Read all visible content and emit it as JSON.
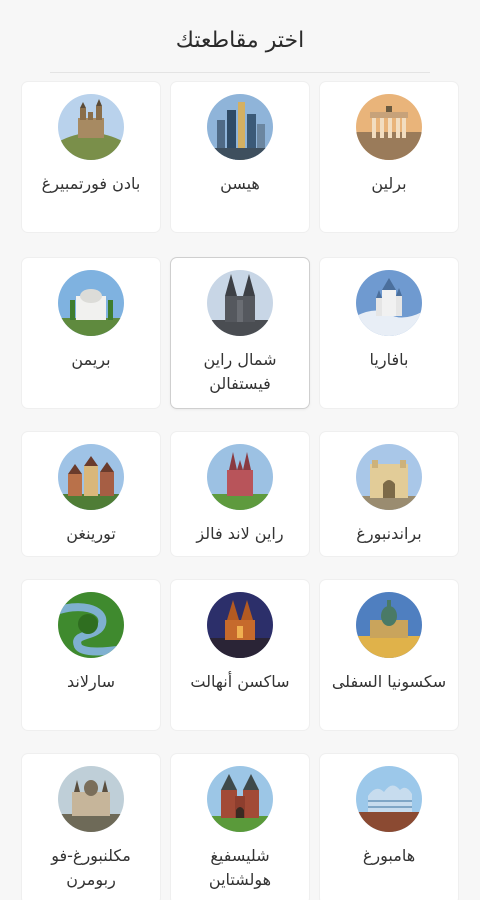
{
  "header": {
    "title": "اختر مقاطعتك"
  },
  "states": [
    {
      "label": "برلين",
      "image": "brandenburg-gate-icon",
      "row": 1
    },
    {
      "label": "هيسن",
      "image": "frankfurt-skyline-icon",
      "row": 1
    },
    {
      "label": "بادن فورتمبيرغ",
      "image": "castle-hohenzollern-icon",
      "row": 1
    },
    {
      "label": "بافاريا",
      "image": "neuschwanstein-icon",
      "row": 2
    },
    {
      "label": "شمال راين فيستفالن",
      "image": "cologne-cathedral-icon",
      "row": 2,
      "selected": true
    },
    {
      "label": "بريمن",
      "image": "bremen-building-icon",
      "row": 2
    },
    {
      "label": "براندنبورغ",
      "image": "potsdam-gate-icon",
      "row": 3
    },
    {
      "label": "راين لاند فالز",
      "image": "speyer-cathedral-icon",
      "row": 3
    },
    {
      "label": "تورينغن",
      "image": "erfurt-houses-icon",
      "row": 3
    },
    {
      "label": "سكسونيا السفلى",
      "image": "hanover-town-hall-icon",
      "row": 4
    },
    {
      "label": "ساكسن أنهالت",
      "image": "magdeburg-night-icon",
      "row": 4
    },
    {
      "label": "سارلاند",
      "image": "saar-loop-icon",
      "row": 4
    },
    {
      "label": "هامبورغ",
      "image": "elbphilharmonie-icon",
      "row": 5
    },
    {
      "label": "شليسفيغ هولشتاين",
      "image": "holstentor-icon",
      "row": 5
    },
    {
      "label": "مكلنبورغ-فو ربومرن",
      "image": "schwerin-castle-icon",
      "row": 5
    }
  ]
}
